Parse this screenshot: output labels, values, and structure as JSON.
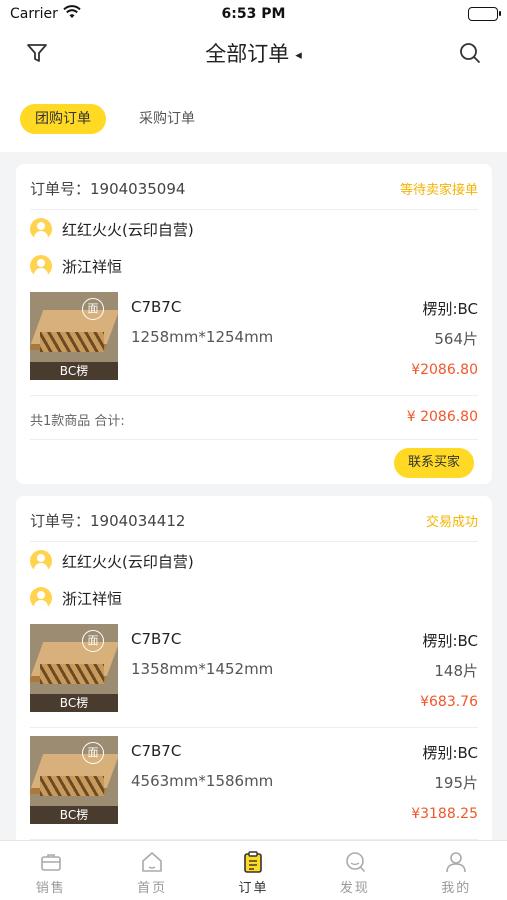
{
  "status_bar": {
    "carrier": "Carrier",
    "time": "6:53 PM"
  },
  "nav": {
    "title": "全部订单",
    "caret": "◂",
    "filter_icon": "filter-icon",
    "search_icon": "search-icon"
  },
  "tabs": [
    {
      "label": "团购订单",
      "active": true
    },
    {
      "label": "采购订单",
      "active": false
    }
  ],
  "orders": [
    {
      "order_label": "订单号：1904035094",
      "status": "等待卖家接单",
      "buyer": "红红火火(云印自营)",
      "seller": "浙江祥恒",
      "products": [
        {
          "name": "C7B7C",
          "size": "1258mm*1254mm",
          "flute": "楞别:BC",
          "qty": "564片",
          "price": "¥2086.80",
          "thumb_face": "面",
          "thumb_type": "BC楞"
        }
      ],
      "summary_count": "共1款商品 合计:",
      "summary_total": "¥ 2086.80",
      "action": "联系买家"
    },
    {
      "order_label": "订单号：1904034412",
      "status": "交易成功",
      "buyer": "红红火火(云印自营)",
      "seller": "浙江祥恒",
      "products": [
        {
          "name": "C7B7C",
          "size": "1358mm*1452mm",
          "flute": "楞别:BC",
          "qty": "148片",
          "price": "¥683.76",
          "thumb_face": "面",
          "thumb_type": "BC楞"
        },
        {
          "name": "C7B7C",
          "size": "4563mm*1586mm",
          "flute": "楞别:BC",
          "qty": "195片",
          "price": "¥3188.25",
          "thumb_face": "面",
          "thumb_type": "BC楞"
        }
      ]
    }
  ],
  "tabbar": [
    {
      "label": "销售",
      "icon": "briefcase-icon",
      "active": false
    },
    {
      "label": "首页",
      "icon": "home-icon",
      "active": false
    },
    {
      "label": "订单",
      "icon": "clipboard-icon",
      "active": true
    },
    {
      "label": "发现",
      "icon": "discover-icon",
      "active": false
    },
    {
      "label": "我的",
      "icon": "user-icon",
      "active": false
    }
  ],
  "colors": {
    "accent": "#ffd923",
    "price": "#f2572a",
    "status": "#f4b400"
  }
}
